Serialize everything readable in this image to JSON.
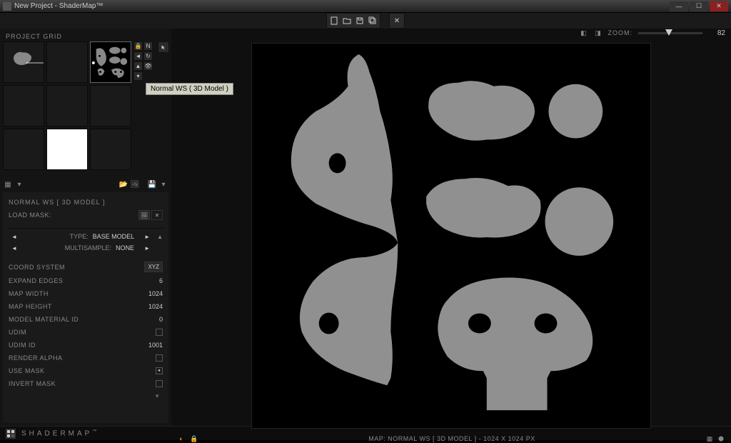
{
  "titlebar": {
    "text": "New Project - ShaderMap™"
  },
  "toolbar": {},
  "projectGrid": {
    "label": "PROJECT GRID"
  },
  "tooltip": "Normal WS ( 3D Model )",
  "properties": {
    "title": "NORMAL WS [ 3D MODEL ]",
    "loadMask": "LOAD MASK:",
    "typeLabel": "TYPE:",
    "typeValue": "BASE MODEL",
    "multisampleLabel": "MULTISAMPLE:",
    "multisampleValue": "NONE",
    "coordSystem": "COORD SYSTEM",
    "coordValue": "XYZ",
    "expandEdges": "EXPAND EDGES",
    "expandValue": "6",
    "mapWidth": "MAP WIDTH",
    "mapWidthValue": "1024",
    "mapHeight": "MAP HEIGHT",
    "mapHeightValue": "1024",
    "modelMaterial": "MODEL MATERIAL ID",
    "modelMaterialValue": "0",
    "udim": "UDIM",
    "udimId": "UDIM ID",
    "udimIdValue": "1001",
    "renderAlpha": "RENDER ALPHA",
    "useMask": "USE MASK",
    "invertMask": "INVERT MASK"
  },
  "viewport": {
    "zoomLabel": "ZOOM:",
    "zoomValue": "82",
    "mapInfo": "MAP: NORMAL WS [ 3D MODEL ]  -  1024 X 1024 PX"
  },
  "status": {
    "brand": "SHADERMAP"
  }
}
